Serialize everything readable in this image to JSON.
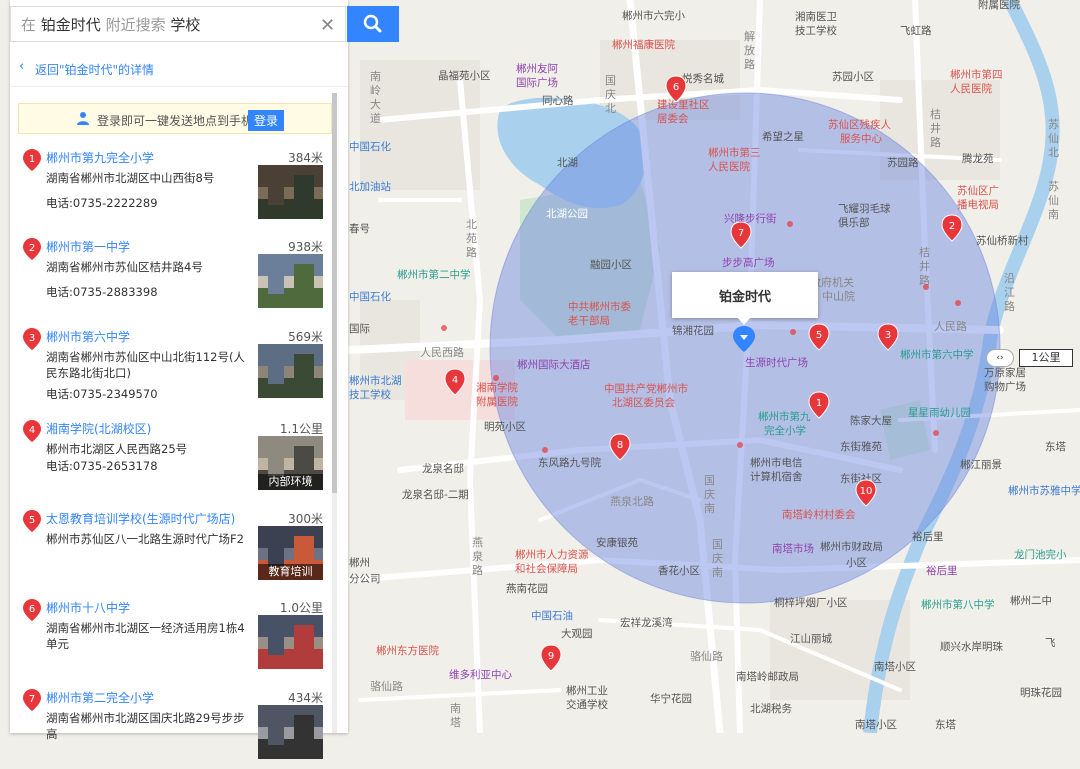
{
  "search": {
    "prefix": "在",
    "center": "铂金时代",
    "middle": "附近搜索",
    "keyword": "学校"
  },
  "back_link": "返回\"铂金时代\"的详情",
  "login": {
    "text": "登录即可一键发送地点到手机",
    "button": "登录"
  },
  "results": [
    {
      "num": "1",
      "name": "郴州市第九完全小学",
      "dist": "384米",
      "addr": "湖南省郴州市北湖区中山西街8号",
      "tel": "电话:0735-2222289",
      "thumb_caption": ""
    },
    {
      "num": "2",
      "name": "郴州市第一中学",
      "dist": "938米",
      "addr": "湖南省郴州市苏仙区桔井路4号",
      "tel": "电话:0735-2883398",
      "thumb_caption": ""
    },
    {
      "num": "3",
      "name": "郴州市第六中学",
      "dist": "569米",
      "addr": "湖南省郴州市苏仙区中山北街112号(人民东路北街北口)",
      "tel": "电话:0735-2349570",
      "thumb_caption": ""
    },
    {
      "num": "4",
      "name": "湘南学院(北湖校区)",
      "dist": "1.1公里",
      "addr": "郴州市北湖区人民西路25号",
      "tel": "电话:0735-2653178",
      "thumb_caption": "内部环境"
    },
    {
      "num": "5",
      "name": "太恩教育培训学校(生源时代广场店)",
      "dist": "300米",
      "addr": "郴州市苏仙区八一北路生源时代广场F2",
      "tel": "",
      "thumb_caption": "教育培训"
    },
    {
      "num": "6",
      "name": "郴州市十八中学",
      "dist": "1.0公里",
      "addr": "湖南省郴州市北湖区一经济适用房1栋4单元",
      "tel": "",
      "thumb_caption": ""
    },
    {
      "num": "7",
      "name": "郴州市第二完全小学",
      "dist": "434米",
      "addr": "湖南省郴州市北湖区国庆北路29号步步高",
      "tel": "",
      "thumb_caption": ""
    }
  ],
  "map": {
    "callout": "铂金时代",
    "scale": "1公里",
    "markers": [
      "1",
      "2",
      "3",
      "4",
      "5",
      "6",
      "7",
      "8",
      "9",
      "10"
    ],
    "labels": [
      "郴州市六完小",
      "湘南医卫技工学校",
      "附属医院",
      "飞虹路",
      "苏园小区",
      "郴州市第四人民医院",
      "晶福苑小区",
      "郴州友阿国际广场",
      "郴州福康医院",
      "同心路",
      "建设里社区居委会",
      "悦秀名城",
      "希望之星",
      "苏仙区残疾人服务中心",
      "郴州市第三人民医院",
      "兴隆步行街",
      "飞耀羽毛球俱乐部",
      "步步高广场",
      "苏仙区广播电视局",
      "苏仙桥新村",
      "腾龙苑",
      "中国石化",
      "北湖",
      "北湖公园",
      "融园小区",
      "中共郴州市委老干部局",
      "郴州市国际大酒店",
      "锦湘花园",
      "生源时代广场",
      "郴州市第六中学",
      "万原家居购物广场",
      "中国共产党郴州市北湖区委员会",
      "湘南学院附属医院",
      "明苑小区",
      "东风路九号院",
      "郴州市第九完全小学",
      "陈家大屋",
      "东街雅苑",
      "星星雨幼儿园",
      "郴江丽景",
      "郴州市电信计算机宿舍",
      "东街社区",
      "南塔岭村村委会",
      "龙泉名邸",
      "龙泉名邸-二期",
      "燕泉北路",
      "安康银苑",
      "香花小区",
      "南塔市场",
      "郴州市财政局小区",
      "裕后里",
      "郴州市人力资源和社会保障局",
      "燕南花园",
      "中国石油",
      "大观园",
      "宏祥龙溪湾",
      "桐梓坪烟厂小区",
      "郴州东方医院",
      "维多利亚中心",
      "郴州工业交通学校",
      "华宁花园",
      "江山丽城",
      "南塔岭邮政局",
      "南塔小区",
      "北湖税务",
      "顺兴水岸明珠",
      "明珠花园",
      "郴州市第八中学",
      "龙门池完小",
      "郴州市苏雅中学",
      "郴州市二中",
      "东塔路",
      "人民西路",
      "人民路",
      "中山街",
      "国庆北路",
      "国庆南路",
      "北苑路",
      "解放路",
      "桔井路",
      "苏仙南路",
      "南岭大道",
      "燕泉路",
      "新华路",
      "骆仙路",
      "中国石化",
      "北加油站",
      "南塔岭",
      "沿江路"
    ]
  },
  "colors": {
    "accent": "#3385ff",
    "marker": "#e8373a",
    "circle": "#6a86e0"
  }
}
